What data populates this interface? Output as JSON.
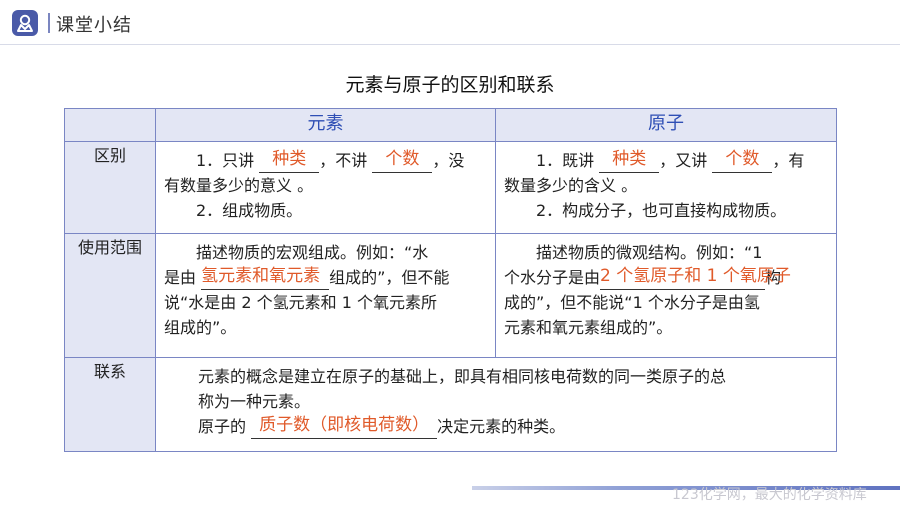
{
  "header": {
    "title": "课堂小结",
    "logo_icon": "book-user-icon",
    "accent": "#4a5aa8"
  },
  "main_title": "元素与原子的区别和联系",
  "table": {
    "col_headers": [
      "元素",
      "原子"
    ],
    "rows": {
      "diff": {
        "label": "区别",
        "element": {
          "l1_pre": "1．只讲",
          "l1_ans1": "种类",
          "l1_mid": "，不讲",
          "l1_ans2": "个数",
          "l1_post": "，没",
          "l2": "有数量多少的意义 。",
          "l3": "2．组成物质。"
        },
        "atom": {
          "l1_pre": "1．既讲",
          "l1_ans1": "种类",
          "l1_mid": "，又讲",
          "l1_ans2": "个数",
          "l1_post": "，有",
          "l2": "数量多少的含义 。",
          "l3": "2．构成分子，也可直接构成物质。"
        }
      },
      "scope": {
        "label": "使用范围",
        "element": {
          "l1": "描述物质的宏观组成。例如：“水",
          "l2_pre": "是由",
          "l2_ans": "氢元素和氧元素",
          "l2_post": "组成的”，但不能",
          "l3": "说“水是由 2 个氢元素和 1 个氧元素所",
          "l4": "组成的”。"
        },
        "atom": {
          "l1": "描述物质的微观结构。例如：“1",
          "l2_pre": "个水分子是由",
          "l2_ans": "2 个氢原子和 1 个氧原子",
          "l2_post": "构",
          "l3": "成的”，但不能说“1 个水分子是由氢",
          "l4": "元素和氧元素组成的”。"
        }
      },
      "link": {
        "label": "联系",
        "l1": "元素的概念是建立在原子的基础上，即具有相同核电荷数的同一类原子的总",
        "l2": "称为一种元素。",
        "l3_pre": "原子的",
        "l3_ans": "质子数（即核电荷数）",
        "l3_post": "决定元素的种类。"
      }
    }
  },
  "footer": {
    "text": "123化学网，最大的化学资料库"
  },
  "colors": {
    "answer": "#e05a2a",
    "header_text": "#2f4fb5",
    "border": "#7a86c4",
    "header_bg": "#e3e6f4"
  }
}
